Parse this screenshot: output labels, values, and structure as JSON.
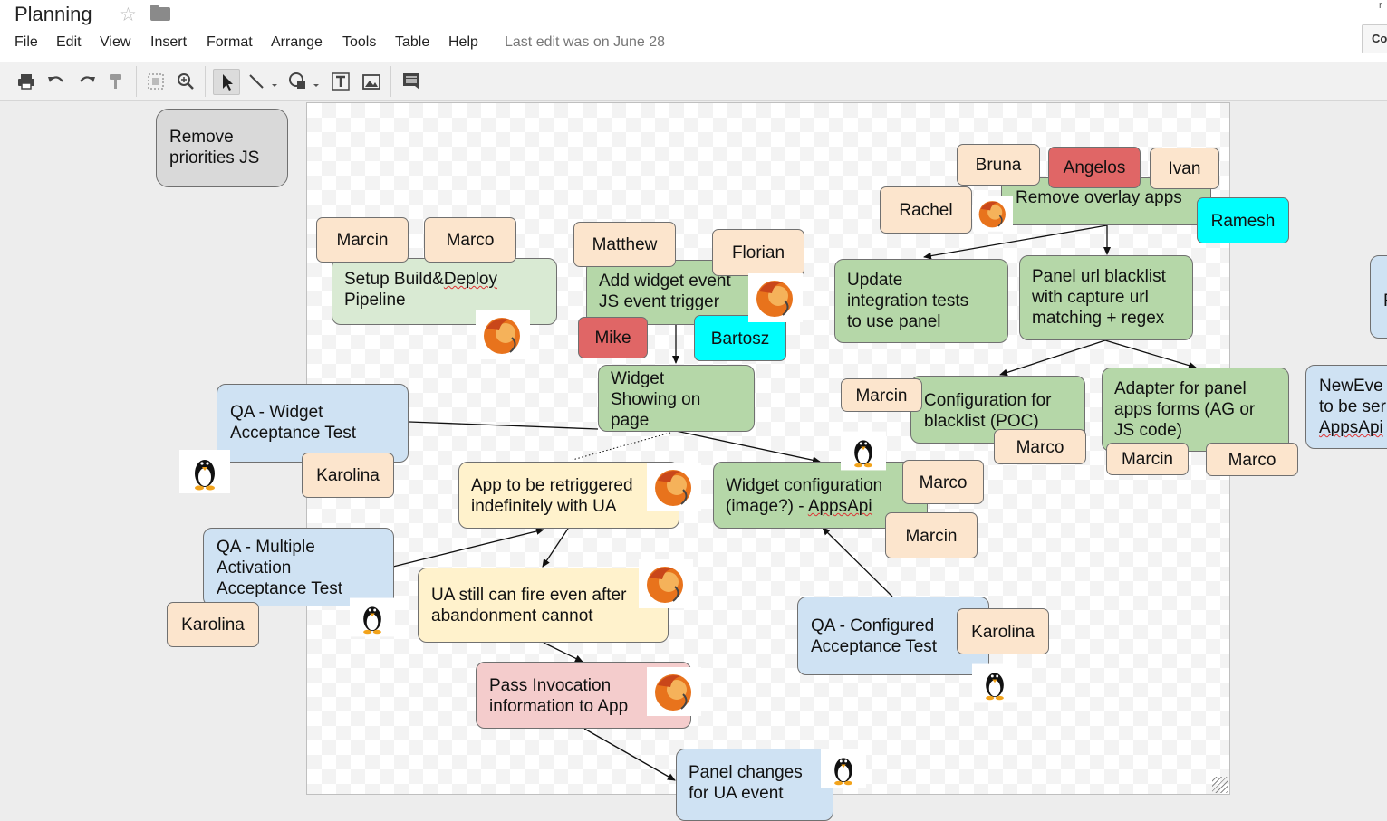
{
  "header": {
    "title": "Planning",
    "last_edit": "Last edit was on June 28",
    "comments_label": "Co",
    "corner_label": "r",
    "menu": [
      "File",
      "Edit",
      "View",
      "Insert",
      "Format",
      "Arrange",
      "Tools",
      "Table",
      "Help"
    ]
  },
  "nodes": {
    "remove_priorities": "Remove\npriorities JS",
    "setup_pipeline_a": "Setup Build&",
    "setup_pipeline_b": "Deploy",
    "setup_pipeline_c": "\nPipeline",
    "add_widget_event": "Add widget event\nJS event trigger",
    "widget_showing": "Widget\nShowing on\npage",
    "remove_overlay": "Remove overlay apps",
    "update_integration": "Update\nintegration tests\nto use panel",
    "panel_blacklist": "Panel url blacklist\nwith capture url\nmatching + regex",
    "config_blacklist": "Configuration for\nblacklist (POC)",
    "adapter_panel": "Adapter for panel\napps forms (AG or\nJS code)",
    "newevent_a": "NewEve\nto be ser\n",
    "newevent_b": "AppsApi",
    "qa_widget": "QA - Widget\nAcceptance Test",
    "app_retriggered": "App to be retriggered\nindefinitely with UA",
    "widget_config_a": "Widget configuration\n(image?) - ",
    "widget_config_b": "AppsApi",
    "qa_multiple": "QA - Multiple\nActivation\nAcceptance Test",
    "ua_still_fire": "UA still can fire even after\nabandonment cannot",
    "qa_configured": "QA - Configured\nAcceptance Test",
    "pass_invocation": "Pass Invocation\ninformation to App",
    "panel_changes": "Panel changes\nfor UA event",
    "edge_stub": "F"
  },
  "people": {
    "marcin_1": "Marcin",
    "marco_1": "Marco",
    "matthew": "Matthew",
    "florian": "Florian",
    "mike": "Mike",
    "bartosz": "Bartosz",
    "bruna": "Bruna",
    "angelos": "Angelos",
    "ivan": "Ivan",
    "rachel": "Rachel",
    "ramesh": "Ramesh",
    "marcin_2": "Marcin",
    "marco_2": "Marco",
    "marcin_3": "Marcin",
    "marco_3": "Marco",
    "marco_4": "Marco",
    "marcin_4": "Marcin",
    "karolina_1": "Karolina",
    "karolina_2": "Karolina",
    "karolina_3": "Karolina"
  },
  "colors": {
    "green": "#b5d7a8",
    "light_green": "#d9ead3",
    "blue": "#cfe2f3",
    "yellow": "#fff2cc",
    "pink": "#f4cccc",
    "gray": "#d9d9d9",
    "peach": "#fce5cd",
    "red": "#e06666",
    "cyan": "#00ffff"
  },
  "icons": {
    "toolbar": [
      "print-icon",
      "undo-icon",
      "redo-icon",
      "paint-format-icon",
      "zoom-fit-icon",
      "zoom-icon",
      "select-pointer-icon",
      "line-icon",
      "shape-icon",
      "text-box-icon",
      "image-icon",
      "comment-icon"
    ],
    "avatars": [
      "firefox-logo",
      "linux-penguin"
    ]
  }
}
